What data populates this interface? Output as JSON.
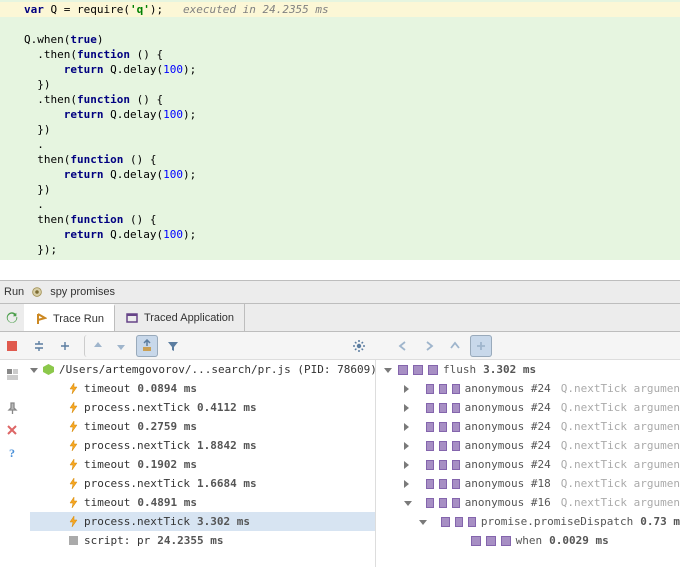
{
  "editor": {
    "line1_kw": "var",
    "line1_id": " Q = ",
    "line1_call": "require(",
    "line1_str": "'q'",
    "line1_end": ");",
    "line1_comment": "   executed in 24.2355 ms",
    "l2a": "Q.when(",
    "l2b": "true",
    "l2c": ")",
    "l3a": "  .then(",
    "l3b": "function",
    "l3c": " () {",
    "l4a": "      ",
    "l4b": "return",
    "l4c": " Q.delay(",
    "l4d": "100",
    "l4e": ");",
    "l5": "  })",
    "l6a": "  .then(",
    "l6b": "function",
    "l6c": " () {",
    "l7a": "      ",
    "l7b": "return",
    "l7c": " Q.delay(",
    "l7d": "100",
    "l7e": ");",
    "l8": "  })",
    "l9": "  .",
    "l10a": "  then(",
    "l10b": "function",
    "l10c": " () {",
    "l11a": "      ",
    "l11b": "return",
    "l11c": " Q.delay(",
    "l11d": "100",
    "l11e": ");",
    "l12": "  })",
    "l13": "  .",
    "l14a": "  then(",
    "l14b": "function",
    "l14c": " () {",
    "l15a": "      ",
    "l15b": "return",
    "l15c": " Q.delay(",
    "l15d": "100",
    "l15e": ");",
    "l16": "  });"
  },
  "runbar": {
    "label": "Run",
    "config": "spy promises"
  },
  "tabs": {
    "trace": "Trace Run",
    "traced": "Traced Application"
  },
  "leftTree": {
    "root": "/Users/artemgovorov/...search/pr.js (PID: 78609)",
    "rows": [
      {
        "name": "timeout",
        "time": "0.0894 ms"
      },
      {
        "name": "process.nextTick",
        "time": "0.4112 ms"
      },
      {
        "name": "timeout",
        "time": "0.2759 ms"
      },
      {
        "name": "process.nextTick",
        "time": "1.8842 ms"
      },
      {
        "name": "timeout",
        "time": "0.1902 ms"
      },
      {
        "name": "process.nextTick",
        "time": "1.6684 ms"
      },
      {
        "name": "timeout",
        "time": "0.4891 ms"
      },
      {
        "name": "process.nextTick",
        "time": "3.302 ms",
        "sel": true
      },
      {
        "name": "script: pr",
        "time": "24.2355 ms",
        "icon": "gray"
      }
    ]
  },
  "rightTree": {
    "root": {
      "name": "flush",
      "time": "3.302 ms"
    },
    "rows": [
      {
        "ind": 1,
        "name": "anonymous #24",
        "hint": "Q.nextTick argumen"
      },
      {
        "ind": 1,
        "name": "anonymous #24",
        "hint": "Q.nextTick argumen"
      },
      {
        "ind": 1,
        "name": "anonymous #24",
        "hint": "Q.nextTick argumen"
      },
      {
        "ind": 1,
        "name": "anonymous #24",
        "hint": "Q.nextTick argumen"
      },
      {
        "ind": 1,
        "name": "anonymous #24",
        "hint": "Q.nextTick argumen"
      },
      {
        "ind": 1,
        "name": "anonymous #18",
        "hint": "Q.nextTick argumen"
      },
      {
        "ind": 1,
        "name": "anonymous #16",
        "hint": "Q.nextTick argumen",
        "open": true
      },
      {
        "ind": 2,
        "name": "promise.promiseDispatch",
        "time": "0.73 m",
        "open": true
      },
      {
        "ind": 3,
        "name": "when",
        "time": "0.0029 ms",
        "noarrow": true
      }
    ]
  }
}
